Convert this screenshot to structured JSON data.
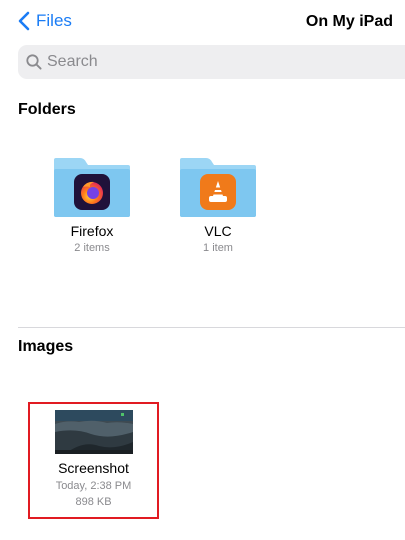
{
  "nav": {
    "back_label": "Files",
    "title": "On My iPad"
  },
  "search": {
    "placeholder": "Search"
  },
  "sections": {
    "folders_title": "Folders",
    "images_title": "Images"
  },
  "folders": [
    {
      "name": "Firefox",
      "meta": "2 items",
      "icon": "firefox-app-icon"
    },
    {
      "name": "VLC",
      "meta": "1 item",
      "icon": "vlc-cone-icon"
    }
  ],
  "images": [
    {
      "name": "Screenshot",
      "date": "Today, 2:38 PM",
      "size": "898 KB",
      "selected": true
    }
  ],
  "colors": {
    "accent": "#1a7cf5",
    "folder": "#7ec7f0",
    "folder_tab": "#9cd6f5",
    "selection_border": "#e11b22",
    "secondary_text": "#8a8a8e"
  }
}
